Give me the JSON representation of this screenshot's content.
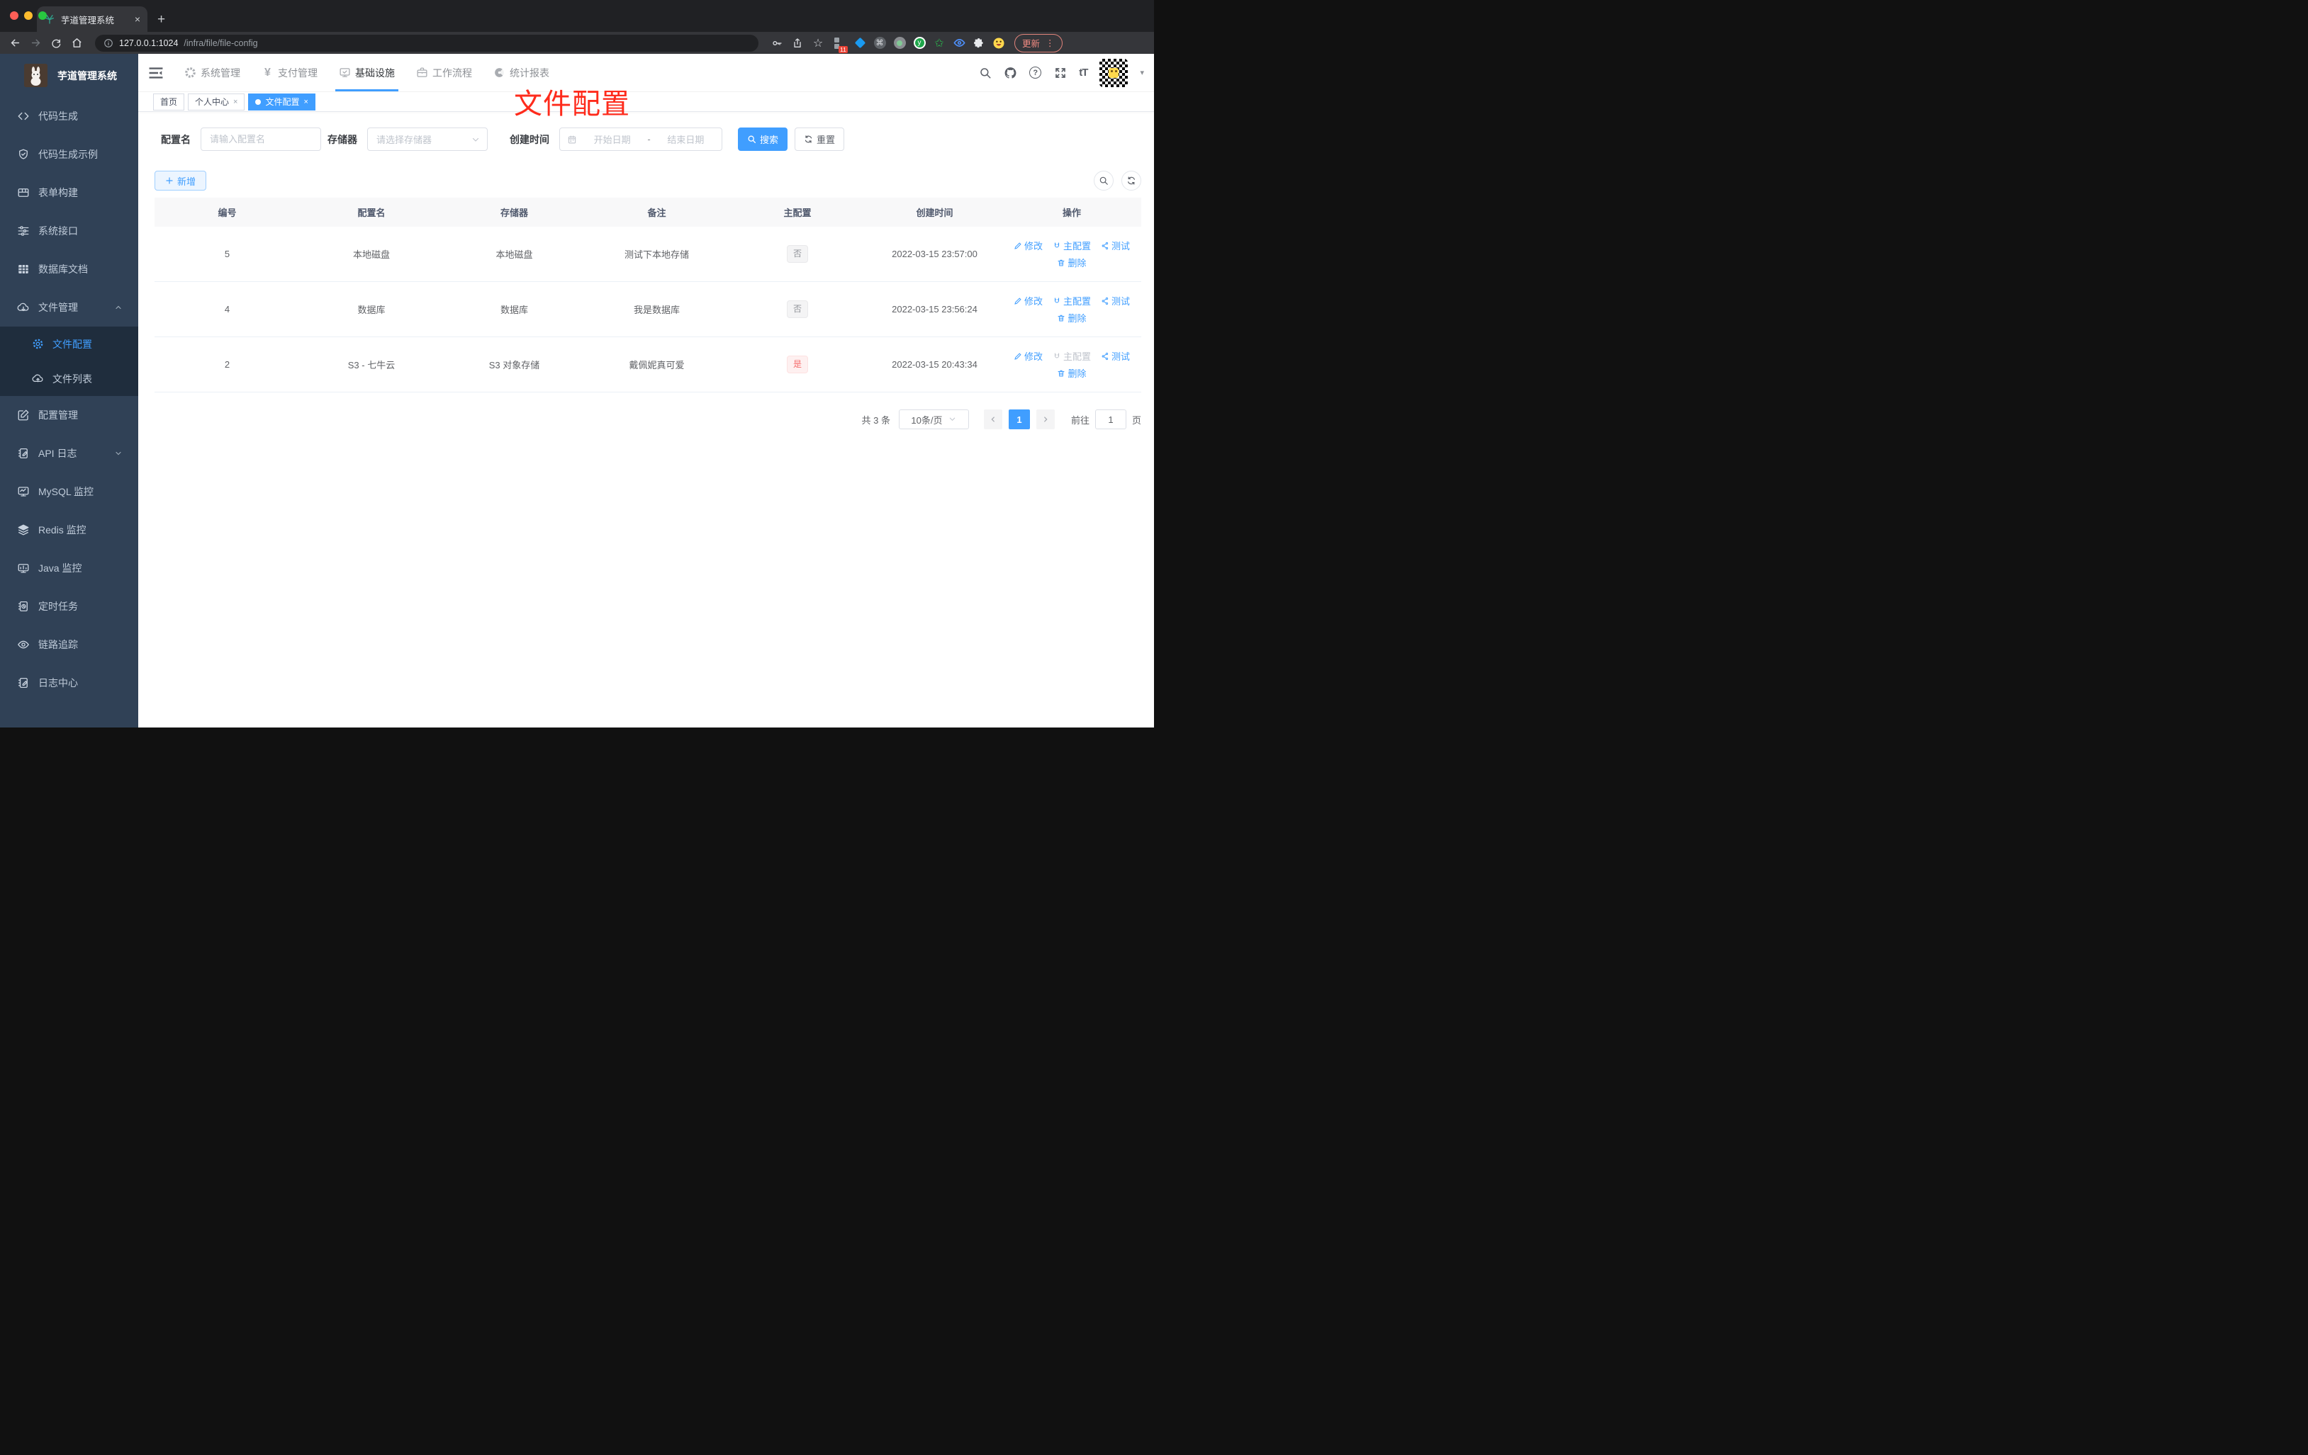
{
  "icons": {
    "close": "×",
    "plus": "+",
    "dots": "⋮",
    "caret_down": "▾",
    "cmd": "⌘",
    "question": "?",
    "font_size": "tT",
    "yen": "¥",
    "star": "☆",
    "green_star": "✩",
    "y_letter": "y"
  },
  "browser": {
    "tab_title": "芋道管理系统",
    "url_host": "127.0.0.1:1024",
    "url_path": "/infra/file/file-config",
    "ext_badge": "11",
    "update_label": "更新"
  },
  "sidebar": {
    "title": "芋道管理系统",
    "items": [
      {
        "label": "代码生成"
      },
      {
        "label": "代码生成示例"
      },
      {
        "label": "表单构建"
      },
      {
        "label": "系统接口"
      },
      {
        "label": "数据库文档"
      },
      {
        "label": "文件管理"
      },
      {
        "label": "配置管理"
      },
      {
        "label": "API 日志"
      },
      {
        "label": "MySQL 监控"
      },
      {
        "label": "Redis 监控"
      },
      {
        "label": "Java 监控"
      },
      {
        "label": "定时任务"
      },
      {
        "label": "链路追踪"
      },
      {
        "label": "日志中心"
      }
    ],
    "submenu": [
      {
        "label": "文件配置"
      },
      {
        "label": "文件列表"
      }
    ]
  },
  "topnav": {
    "menus": [
      {
        "label": "系统管理"
      },
      {
        "label": "支付管理"
      },
      {
        "label": "基础设施"
      },
      {
        "label": "工作流程"
      },
      {
        "label": "统计报表"
      }
    ]
  },
  "tags": [
    {
      "label": "首页"
    },
    {
      "label": "个人中心"
    },
    {
      "label": "文件配置"
    }
  ],
  "annotation": {
    "text": "文件配置",
    "color": "#fe2b1c"
  },
  "filters": {
    "config_name": {
      "label": "配置名",
      "placeholder": "请输入配置名"
    },
    "storage": {
      "label": "存储器",
      "placeholder": "请选择存储器"
    },
    "create_time": {
      "label": "创建时间",
      "start_placeholder": "开始日期",
      "separator": "-",
      "end_placeholder": "结束日期"
    },
    "search_label": "搜索",
    "reset_label": "重置"
  },
  "toolbar": {
    "add_label": "新增"
  },
  "table": {
    "columns": [
      "编号",
      "配置名",
      "存储器",
      "备注",
      "主配置",
      "创建时间",
      "操作"
    ],
    "actions": {
      "edit": "修改",
      "master": "主配置",
      "test": "测试",
      "delete": "删除"
    },
    "rows": [
      {
        "id": "5",
        "name": "本地磁盘",
        "storage": "本地磁盘",
        "remark": "测试下本地存储",
        "master": "否",
        "created": "2022-03-15 23:57:00"
      },
      {
        "id": "4",
        "name": "数据库",
        "storage": "数据库",
        "remark": "我是数据库",
        "master": "否",
        "created": "2022-03-15 23:56:24"
      },
      {
        "id": "2",
        "name": "S3 - 七牛云",
        "storage": "S3 对象存储",
        "remark": "戴佩妮真可爱",
        "master": "是",
        "created": "2022-03-15 20:43:34"
      }
    ]
  },
  "pagination": {
    "total": "共 3 条",
    "page_size": "10条/页",
    "current": "1",
    "goto": "前往",
    "goto_value": "1",
    "page_unit": "页"
  },
  "colors": {
    "accent": "#409eff",
    "danger": "#f56c6c",
    "sidebar_bg": "#304156",
    "submenu_bg": "#1f2d3d"
  }
}
